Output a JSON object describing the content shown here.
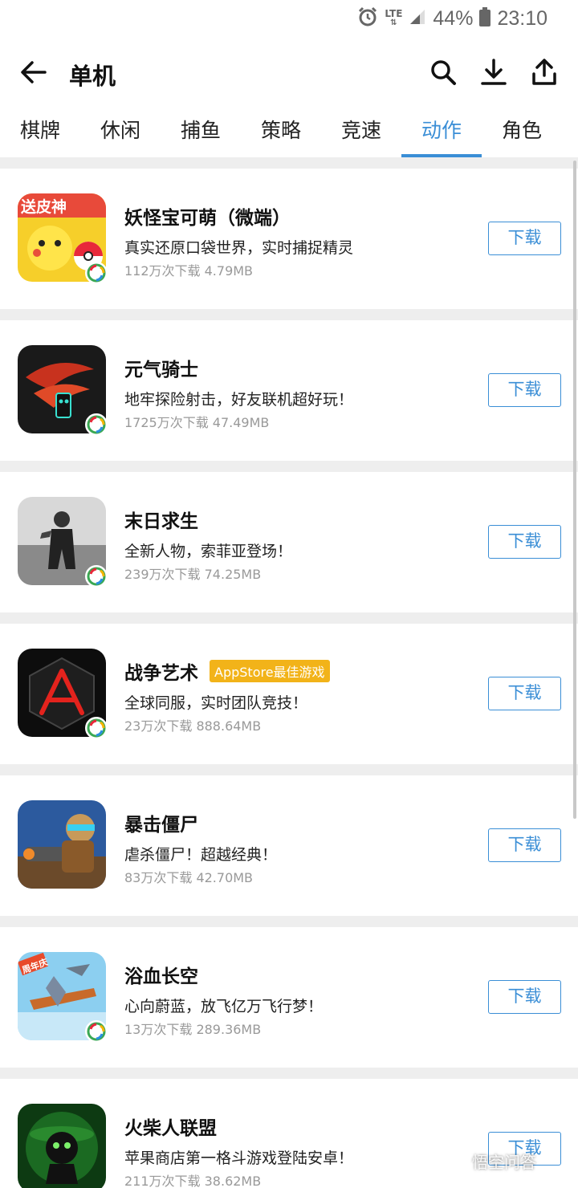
{
  "status_bar": {
    "network": "LTE",
    "battery_percent": "44%",
    "time": "23:10",
    "icons": [
      "alarm-icon",
      "signal-icon",
      "battery-icon"
    ]
  },
  "app_bar": {
    "title": "单机",
    "actions": [
      "search-icon",
      "download-icon",
      "upload-icon"
    ]
  },
  "tabs": [
    {
      "label": "棋牌"
    },
    {
      "label": "休闲"
    },
    {
      "label": "捕鱼"
    },
    {
      "label": "策略"
    },
    {
      "label": "竞速"
    },
    {
      "label": "动作",
      "active": true
    },
    {
      "label": "角色"
    }
  ],
  "apps": [
    {
      "name": "妖怪宝可萌（微端）",
      "tag": "",
      "desc": "真实还原口袋世界，实时捕捉精灵",
      "meta": "112万次下载 4.79MB",
      "button": "下载",
      "icon_text": "送皮神"
    },
    {
      "name": "元气骑士",
      "tag": "",
      "desc": "地牢探险射击，好友联机超好玩！",
      "meta": "1725万次下载 47.49MB",
      "button": "下载"
    },
    {
      "name": "末日求生",
      "tag": "",
      "desc": "全新人物，索菲亚登场！",
      "meta": "239万次下载 74.25MB",
      "button": "下载"
    },
    {
      "name": "战争艺术",
      "tag": "AppStore最佳游戏",
      "desc": "全球同服，实时团队竞技！",
      "meta": "23万次下载 888.64MB",
      "button": "下载"
    },
    {
      "name": "暴击僵尸",
      "tag": "",
      "desc": "虐杀僵尸！超越经典！",
      "meta": "83万次下载 42.70MB",
      "button": "下载"
    },
    {
      "name": "浴血长空",
      "tag": "",
      "desc": "心向蔚蓝，放飞亿万飞行梦！",
      "meta": "13万次下载 289.36MB",
      "button": "下载",
      "icon_text": "周年庆"
    },
    {
      "name": "火柴人联盟",
      "tag": "",
      "desc": "苹果商店第一格斗游戏登陆安卓！",
      "meta": "211万次下载 38.62MB",
      "button": "下载"
    }
  ],
  "watermark": "悟空问答"
}
